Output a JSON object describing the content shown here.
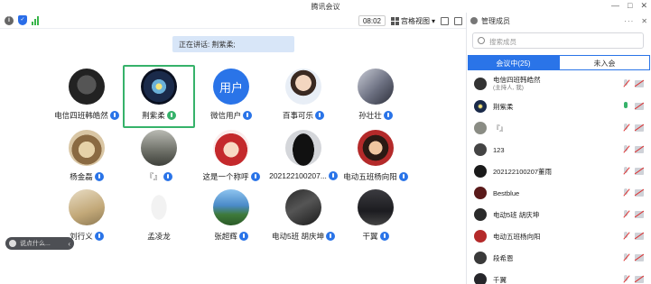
{
  "window": {
    "title": "腾讯会议"
  },
  "toolbar": {
    "timer": "08:02",
    "view_label": "宫格视图"
  },
  "speaking": {
    "text": "正在讲话: 荆紫柔;"
  },
  "participants": [
    {
      "name": "电信四班韩皓然",
      "mic": "blue"
    },
    {
      "name": "荆紫柔",
      "mic": "green"
    },
    {
      "name": "微信用户",
      "mic": "blue",
      "avatar_text": "用户"
    },
    {
      "name": "百事可乐",
      "mic": "blue"
    },
    {
      "name": "孙壮壮",
      "mic": "blue"
    },
    {
      "name": "杨金磊",
      "mic": "blue"
    },
    {
      "name": "『』",
      "mic": "blue"
    },
    {
      "name": "这是一个称呼",
      "mic": "blue"
    },
    {
      "name": "202122100207...",
      "mic": "blue"
    },
    {
      "name": "电动五班杨向阳",
      "mic": "blue"
    },
    {
      "name": "刘行义",
      "mic": "blue"
    },
    {
      "name": "孟凌龙",
      "mic": "none"
    },
    {
      "name": "张超辉",
      "mic": "blue"
    },
    {
      "name": "电动5班 胡庆坤",
      "mic": "blue"
    },
    {
      "name": "干翼",
      "mic": "blue"
    }
  ],
  "chat": {
    "placeholder": "说点什么..."
  },
  "panel": {
    "title": "管理成员",
    "search_placeholder": "搜索成员",
    "tab_in": "会议中(25)",
    "tab_out": "未入会",
    "members": [
      {
        "name": "电信四班韩皓然",
        "sub": "(主持人, 我)",
        "mic": "off"
      },
      {
        "name": "荆紫柔",
        "mic": "on"
      },
      {
        "name": "『』",
        "mic": "off"
      },
      {
        "name": "123",
        "mic": "off"
      },
      {
        "name": "202122100207董雨",
        "mic": "off"
      },
      {
        "name": "Bestblue",
        "mic": "off"
      },
      {
        "name": "电动5班 胡庆坤",
        "mic": "off"
      },
      {
        "name": "电动五班杨向阳",
        "mic": "off"
      },
      {
        "name": "段希恩",
        "mic": "off"
      },
      {
        "name": "千翼",
        "mic": "off"
      }
    ]
  },
  "colors": {
    "accent": "#2a74e8",
    "speaking": "#36b26a",
    "banner": "#d8e6f8"
  }
}
